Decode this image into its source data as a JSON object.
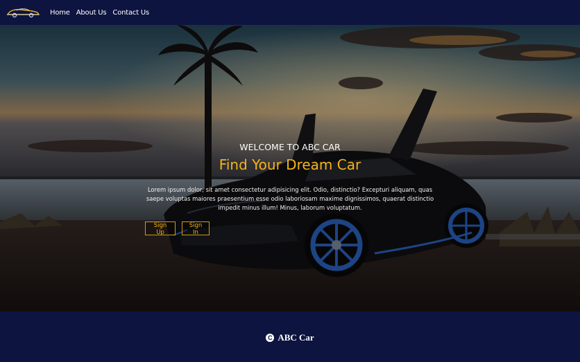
{
  "nav": {
    "logo_icon": "car-logo-icon",
    "links": [
      "Home",
      "About Us",
      "Contact Us"
    ]
  },
  "hero": {
    "welcome": "WELCOME TO ABC CAR",
    "headline": "Find Your Dream Car",
    "body": "Lorem ipsum dolor, sit amet consectetur adipisicing elit. Odio, distinctio? Excepturi aliquam, quas saepe voluptas maiores praesentium esse odio laboriosam maxime dignissimos, quaerat distinctio impedit minus illum! Minus, laborum voluptatum.",
    "signup_label": "Sign Up",
    "signin_label": "Sign In"
  },
  "footer": {
    "copyright_symbol": "C",
    "brand": "ABC Car"
  },
  "colors": {
    "navy": "#0d1440",
    "accent_yellow": "#f5b417",
    "car_wheel_blue": "#2f6fd6"
  }
}
